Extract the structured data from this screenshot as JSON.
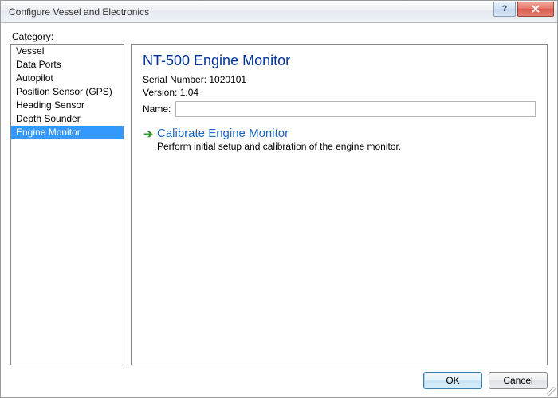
{
  "window": {
    "title": "Configure Vessel and Electronics"
  },
  "category_label_pre": "C",
  "category_label_underlined": "a",
  "category_label_post": "tegory:",
  "categories": [
    "Vessel",
    "Data Ports",
    "Autopilot",
    "Position Sensor (GPS)",
    "Heading Sensor",
    "Depth Sounder",
    "Engine Monitor"
  ],
  "selected_index": 6,
  "device": {
    "title": "NT-500 Engine Monitor",
    "serial_label": "Serial Number:",
    "serial_value": "1020101",
    "version_label": "Version:",
    "version_value": "1.04",
    "name_label": "Name:",
    "name_value": ""
  },
  "action": {
    "link": "Calibrate Engine Monitor",
    "desc": "Perform initial setup and calibration of the engine monitor."
  },
  "buttons": {
    "ok": "OK",
    "cancel": "Cancel"
  }
}
